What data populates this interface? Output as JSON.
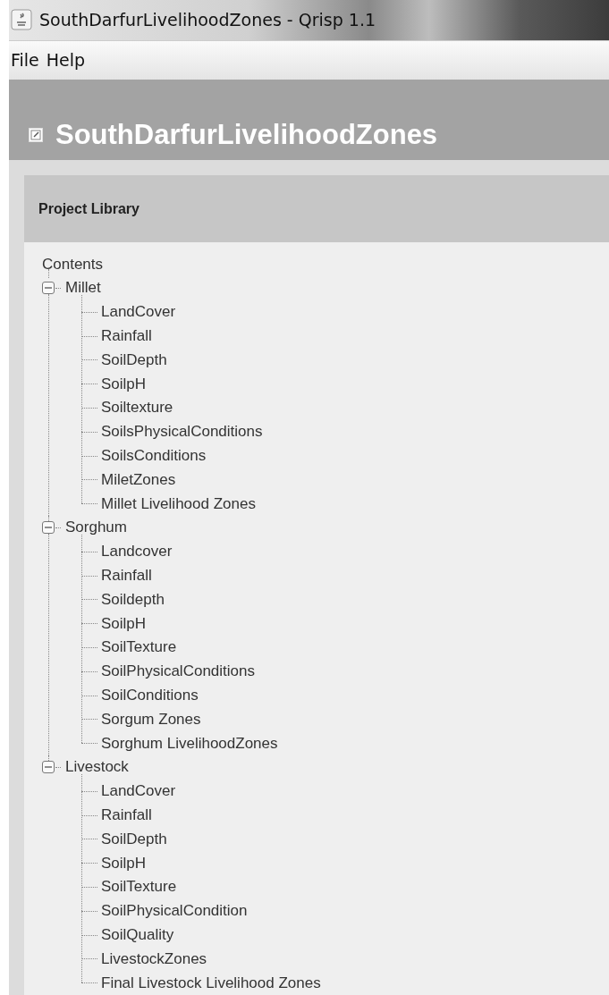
{
  "window": {
    "title": "SouthDarfurLivelihoodZones - Qrisp 1.1"
  },
  "menu": [
    "File",
    "Help"
  ],
  "header": {
    "title": "SouthDarfurLivelihoodZones"
  },
  "panel": {
    "title": "Project Library"
  },
  "tree": {
    "root": "Contents",
    "children": [
      {
        "label": "Millet",
        "expanded": true,
        "children": [
          "LandCover",
          "Rainfall",
          "SoilDepth",
          "SoilpH",
          "Soiltexture",
          "SoilsPhysicalConditions",
          "SoilsConditions",
          "MiletZones",
          "Millet Livelihood Zones"
        ]
      },
      {
        "label": "Sorghum",
        "expanded": true,
        "children": [
          "Landcover",
          "Rainfall",
          "Soildepth",
          "SoilpH",
          "SoilTexture",
          "SoilPhysicalConditions",
          "SoilConditions",
          "Sorgum Zones",
          "Sorghum LivelihoodZones"
        ]
      },
      {
        "label": "Livestock",
        "expanded": true,
        "children": [
          "LandCover",
          "Rainfall",
          "SoilDepth",
          "SoilpH",
          "SoilTexture",
          "SoilPhysicalCondition",
          "SoilQuality",
          "LivestockZones",
          "Final Livestock Livelihood Zones"
        ]
      }
    ]
  }
}
